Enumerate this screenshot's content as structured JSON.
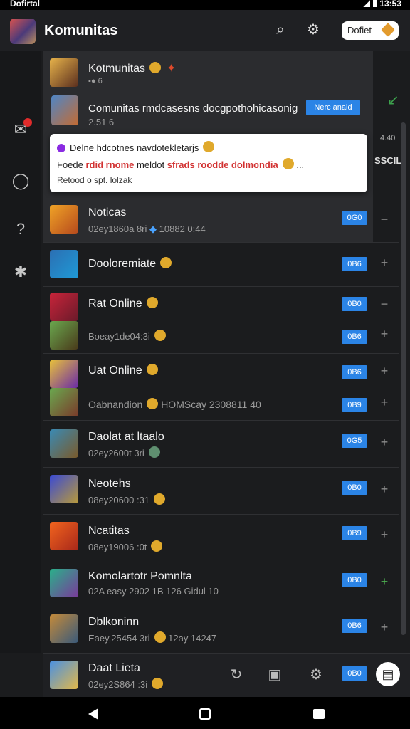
{
  "status_bar": {
    "carrier": "Dofirtal",
    "time": "13:53"
  },
  "app_bar": {
    "title": "Komunitas",
    "pill_label": "Dofiet"
  },
  "popover": {
    "header": {
      "title": "Kotmunitas",
      "subtitle": "6"
    },
    "item": {
      "title": "Comunitas rmdcasesns docgpothohicasonig",
      "subtitle": "2.51 6",
      "button": "Nerc anald"
    },
    "message": {
      "line1": "Delne hdcotnes navdotekletarjs",
      "line2_a": "Foede",
      "line2_b": "rdid rnome",
      "line2_c": "meldot",
      "line2_d": "sfrads roodde dolmondia",
      "line2_e": "...",
      "line3": "Retood o spt. lolzak"
    },
    "side_labels": {
      "a": "4.40",
      "b": "SSCIL"
    }
  },
  "rows": [
    {
      "title": "Noticas",
      "sub": "02ey1860a 8ri",
      "sub2": "10882 0:44",
      "badge": "0G0",
      "action": "−"
    },
    {
      "title": "Dooloremiate",
      "sub": "",
      "badge": "0B6",
      "action": "+"
    },
    {
      "title": "Rat Online",
      "sub": "",
      "badge": "0B0",
      "action": "−"
    },
    {
      "title": "",
      "sub": "Boeay1de04:3i",
      "badge": "0B6",
      "action": "+"
    },
    {
      "title": "Uat Online",
      "sub": "",
      "badge": "0B6",
      "action": "+"
    },
    {
      "title": "",
      "sub": "Oabnandion",
      "sub2": "HOMScay 2308811 40",
      "badge": "0B9",
      "action": "+"
    },
    {
      "title": "Daolat at ltaalo",
      "sub": "02ey2600t 3ri",
      "badge": "0G5",
      "action": "+"
    },
    {
      "title": "Neotehs",
      "sub": "08ey20600 :31",
      "badge": "0B0",
      "action": "+"
    },
    {
      "title": "Ncatitas",
      "sub": "08ey19006 :0t",
      "badge": "0B9",
      "action": "+"
    },
    {
      "title": "Komolartotr Pomnlta",
      "sub": "02A easy 2902 1B",
      "sub2": "126 Gidul 10",
      "badge": "0B0",
      "action": "+"
    },
    {
      "title": "Dblkoninn",
      "sub": "Eaey,25454 3ri",
      "sub2": "12ay 14247",
      "badge": "0B6",
      "action": "+"
    },
    {
      "title": "Daat Lieta",
      "sub": "02ey2S864 :3i",
      "badge": "0B0",
      "action": ""
    }
  ],
  "icons": {
    "app": [
      "search-icon",
      "settings-icon"
    ],
    "rail": [
      "inbox-icon",
      "chat-icon",
      "help-icon",
      "bot-icon"
    ],
    "bottom": [
      "refresh-icon",
      "briefcase-icon",
      "gear-icon",
      "phone-icon"
    ]
  }
}
